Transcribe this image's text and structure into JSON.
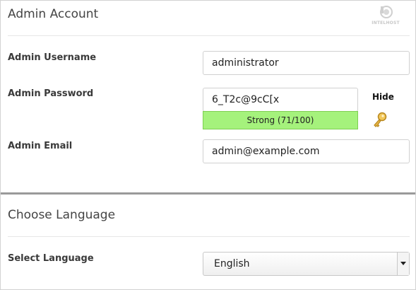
{
  "admin_account": {
    "title": "Admin Account",
    "logo_text": "INTELHOST",
    "username": {
      "label": "Admin Username",
      "value": "administrator"
    },
    "password": {
      "label": "Admin Password",
      "value": "6_T2c@9cC[x",
      "strength_text": "Strong (71/100)",
      "strength_color": "#a5f27c",
      "hide_label": "Hide"
    },
    "email": {
      "label": "Admin Email",
      "value": "admin@example.com"
    }
  },
  "language": {
    "title": "Choose Language",
    "select_label": "Select Language",
    "selected": "English"
  }
}
